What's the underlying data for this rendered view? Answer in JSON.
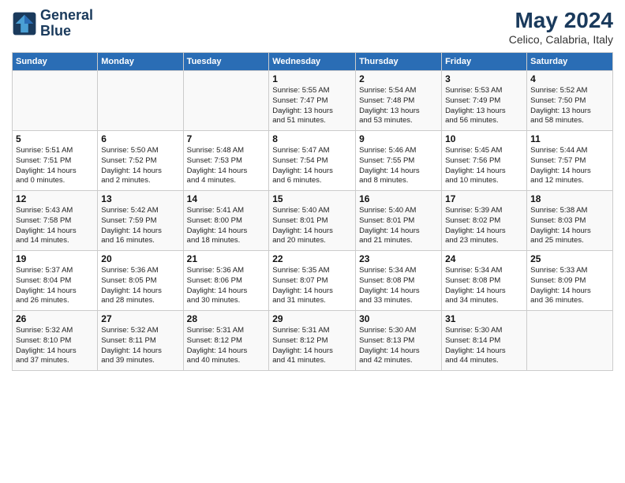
{
  "header": {
    "logo_line1": "General",
    "logo_line2": "Blue",
    "month_year": "May 2024",
    "location": "Celico, Calabria, Italy"
  },
  "weekdays": [
    "Sunday",
    "Monday",
    "Tuesday",
    "Wednesday",
    "Thursday",
    "Friday",
    "Saturday"
  ],
  "weeks": [
    [
      {
        "day": "",
        "info": ""
      },
      {
        "day": "",
        "info": ""
      },
      {
        "day": "",
        "info": ""
      },
      {
        "day": "1",
        "info": "Sunrise: 5:55 AM\nSunset: 7:47 PM\nDaylight: 13 hours\nand 51 minutes."
      },
      {
        "day": "2",
        "info": "Sunrise: 5:54 AM\nSunset: 7:48 PM\nDaylight: 13 hours\nand 53 minutes."
      },
      {
        "day": "3",
        "info": "Sunrise: 5:53 AM\nSunset: 7:49 PM\nDaylight: 13 hours\nand 56 minutes."
      },
      {
        "day": "4",
        "info": "Sunrise: 5:52 AM\nSunset: 7:50 PM\nDaylight: 13 hours\nand 58 minutes."
      }
    ],
    [
      {
        "day": "5",
        "info": "Sunrise: 5:51 AM\nSunset: 7:51 PM\nDaylight: 14 hours\nand 0 minutes."
      },
      {
        "day": "6",
        "info": "Sunrise: 5:50 AM\nSunset: 7:52 PM\nDaylight: 14 hours\nand 2 minutes."
      },
      {
        "day": "7",
        "info": "Sunrise: 5:48 AM\nSunset: 7:53 PM\nDaylight: 14 hours\nand 4 minutes."
      },
      {
        "day": "8",
        "info": "Sunrise: 5:47 AM\nSunset: 7:54 PM\nDaylight: 14 hours\nand 6 minutes."
      },
      {
        "day": "9",
        "info": "Sunrise: 5:46 AM\nSunset: 7:55 PM\nDaylight: 14 hours\nand 8 minutes."
      },
      {
        "day": "10",
        "info": "Sunrise: 5:45 AM\nSunset: 7:56 PM\nDaylight: 14 hours\nand 10 minutes."
      },
      {
        "day": "11",
        "info": "Sunrise: 5:44 AM\nSunset: 7:57 PM\nDaylight: 14 hours\nand 12 minutes."
      }
    ],
    [
      {
        "day": "12",
        "info": "Sunrise: 5:43 AM\nSunset: 7:58 PM\nDaylight: 14 hours\nand 14 minutes."
      },
      {
        "day": "13",
        "info": "Sunrise: 5:42 AM\nSunset: 7:59 PM\nDaylight: 14 hours\nand 16 minutes."
      },
      {
        "day": "14",
        "info": "Sunrise: 5:41 AM\nSunset: 8:00 PM\nDaylight: 14 hours\nand 18 minutes."
      },
      {
        "day": "15",
        "info": "Sunrise: 5:40 AM\nSunset: 8:01 PM\nDaylight: 14 hours\nand 20 minutes."
      },
      {
        "day": "16",
        "info": "Sunrise: 5:40 AM\nSunset: 8:01 PM\nDaylight: 14 hours\nand 21 minutes."
      },
      {
        "day": "17",
        "info": "Sunrise: 5:39 AM\nSunset: 8:02 PM\nDaylight: 14 hours\nand 23 minutes."
      },
      {
        "day": "18",
        "info": "Sunrise: 5:38 AM\nSunset: 8:03 PM\nDaylight: 14 hours\nand 25 minutes."
      }
    ],
    [
      {
        "day": "19",
        "info": "Sunrise: 5:37 AM\nSunset: 8:04 PM\nDaylight: 14 hours\nand 26 minutes."
      },
      {
        "day": "20",
        "info": "Sunrise: 5:36 AM\nSunset: 8:05 PM\nDaylight: 14 hours\nand 28 minutes."
      },
      {
        "day": "21",
        "info": "Sunrise: 5:36 AM\nSunset: 8:06 PM\nDaylight: 14 hours\nand 30 minutes."
      },
      {
        "day": "22",
        "info": "Sunrise: 5:35 AM\nSunset: 8:07 PM\nDaylight: 14 hours\nand 31 minutes."
      },
      {
        "day": "23",
        "info": "Sunrise: 5:34 AM\nSunset: 8:08 PM\nDaylight: 14 hours\nand 33 minutes."
      },
      {
        "day": "24",
        "info": "Sunrise: 5:34 AM\nSunset: 8:08 PM\nDaylight: 14 hours\nand 34 minutes."
      },
      {
        "day": "25",
        "info": "Sunrise: 5:33 AM\nSunset: 8:09 PM\nDaylight: 14 hours\nand 36 minutes."
      }
    ],
    [
      {
        "day": "26",
        "info": "Sunrise: 5:32 AM\nSunset: 8:10 PM\nDaylight: 14 hours\nand 37 minutes."
      },
      {
        "day": "27",
        "info": "Sunrise: 5:32 AM\nSunset: 8:11 PM\nDaylight: 14 hours\nand 39 minutes."
      },
      {
        "day": "28",
        "info": "Sunrise: 5:31 AM\nSunset: 8:12 PM\nDaylight: 14 hours\nand 40 minutes."
      },
      {
        "day": "29",
        "info": "Sunrise: 5:31 AM\nSunset: 8:12 PM\nDaylight: 14 hours\nand 41 minutes."
      },
      {
        "day": "30",
        "info": "Sunrise: 5:30 AM\nSunset: 8:13 PM\nDaylight: 14 hours\nand 42 minutes."
      },
      {
        "day": "31",
        "info": "Sunrise: 5:30 AM\nSunset: 8:14 PM\nDaylight: 14 hours\nand 44 minutes."
      },
      {
        "day": "",
        "info": ""
      }
    ]
  ]
}
